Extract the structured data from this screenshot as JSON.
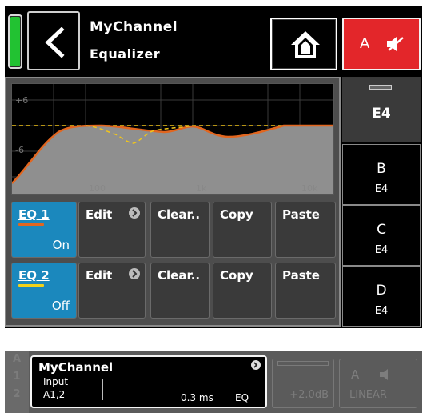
{
  "header": {
    "title": "MyChannel",
    "subtitle": "Equalizer",
    "mute_label": "A",
    "status_color": "#22c232",
    "back_icon": "chevron-left-icon",
    "home_icon": "home-icon",
    "mute_icon": "speaker-muted-icon"
  },
  "graph": {
    "top_label": "+6",
    "mid_label": "-6",
    "freq_labels": [
      "100",
      "1k",
      "10k"
    ],
    "curve_color": "#e2661f",
    "dashed_color": "#f2c61a"
  },
  "eq_rows": [
    {
      "name": "EQ 1",
      "state": "On",
      "indicator_color": "#e2661f",
      "edit": "Edit",
      "clear": "Clear..",
      "copy": "Copy",
      "paste": "Paste"
    },
    {
      "name": "EQ 2",
      "state": "Off",
      "indicator_color": "#f2d21a",
      "edit": "Edit",
      "clear": "Clear..",
      "copy": "Copy",
      "paste": "Paste"
    }
  ],
  "tabs": [
    {
      "label": "E4"
    },
    {
      "label": "B",
      "sub": "E4"
    },
    {
      "label": "C",
      "sub": "E4"
    },
    {
      "label": "D",
      "sub": "E4"
    }
  ],
  "strip": {
    "side_labels": [
      "A",
      "1",
      "2"
    ],
    "channel_name": "MyChannel",
    "input_label": "Input",
    "input_source": "A1,2",
    "delay": "0.3 ms",
    "eq_tag": "EQ",
    "gain": "+2.0dB",
    "mute_label": "A",
    "mode": "LINEAR"
  }
}
